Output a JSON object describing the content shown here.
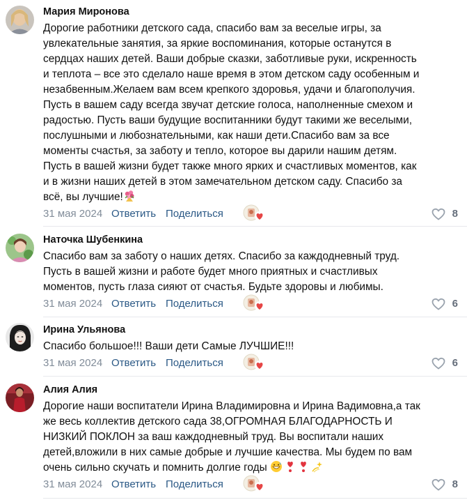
{
  "comments": [
    {
      "author": "Мария Миронова",
      "lines": [
        "Дорогие работники детского сада, спасибо вам за веселые игры, за",
        "увлекательные занятия, за яркие воспоминания, которые останутся в",
        "сердцах наших детей. Ваши добрые сказки, заботливые руки, искренность",
        "и теплота – все это сделало наше время в этом детском саду особенным и",
        "незабвенным.Желаем вам всем крепкого здоровья, удачи и благополучия.",
        "Пусть в вашем саду всегда звучат детские голоса, наполненные смехом и",
        "радостью. Пусть ваши будущие воспитанники будут такими же веселыми,",
        "послушными и любознательными, как наши дети.Спасибо вам за все",
        "моменты счастья, за заботу и тепло, которое вы дарили нашим детям.",
        "Пусть в вашей жизни будет также много ярких и счастливых моментов, как",
        "и в жизни наших детей в этом замечательном детском саду. Спасибо за",
        "всё, вы лучшие!"
      ],
      "date": "31 мая 2024",
      "reply": "Ответить",
      "share": "Поделиться",
      "likes": "8"
    },
    {
      "author": "Наточка Шубенкина",
      "lines": [
        "Спасибо вам за заботу о наших детях. Спасибо за каждодневный труд.",
        "Пусть в вашей жизни и работе будет много приятных и счастливых",
        "моментов, пусть глаза сияют от счастья. Будьте здоровы и любимы."
      ],
      "date": "31 мая 2024",
      "reply": "Ответить",
      "share": "Поделиться",
      "likes": "6"
    },
    {
      "author": "Ирина Ульянова",
      "lines": [
        "Спасибо большое!!! Ваши дети Самые ЛУЧШИЕ!!!"
      ],
      "date": "31 мая 2024",
      "reply": "Ответить",
      "share": "Поделиться",
      "likes": "6"
    },
    {
      "author": "Алия Алия",
      "lines": [
        "Дорогие наши воспитатели Ирина Владимировна и Ирина Вадимовна,а так",
        "же весь коллектив детского сада 38,ОГРОМНАЯ БЛАГОДАРНОСТЬ И",
        "НИЗКИЙ ПОКЛОН за ваш каждодневный труд. Вы воспитали наших",
        "детей,вложили в них самые добрые и лучшие качества. Мы будем по вам",
        "очень сильно скучать и помнить долгие годы"
      ],
      "date": "31 мая 2024",
      "reply": "Ответить",
      "share": "Поделиться",
      "likes": "8"
    }
  ],
  "colors": {
    "link": "#2a5885",
    "meta": "#818c99",
    "like_icon": "#99a2ad",
    "divider": "#e7e8ec"
  },
  "icons": [
    "heart-outline-icon",
    "bouquet-emoji",
    "grinning-sweat-emoji",
    "heart-exclamation-emoji",
    "dizzy-emoji",
    "reaction-avatar-icon",
    "red-heart-reaction-icon"
  ]
}
